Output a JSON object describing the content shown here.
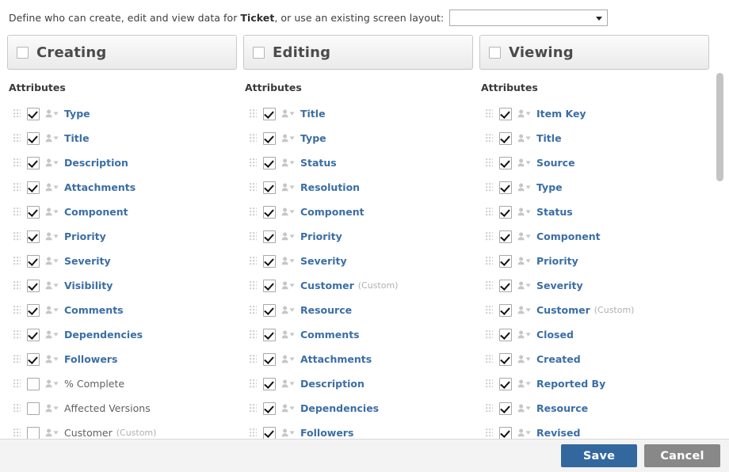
{
  "instruction": {
    "prefix": "Define who can create, edit and view data for ",
    "entity": "Ticket",
    "suffix": ", or use an existing screen layout:"
  },
  "layout_select": {
    "name": "screen-layout-select",
    "value": "",
    "placeholder": "",
    "caret_icon": "chevron-down-icon"
  },
  "attributes_heading": "Attributes",
  "icons": {
    "drag_handle": "drag-handle-icon",
    "person": "person-icon",
    "person_caret": "chevron-down-icon"
  },
  "colors": {
    "label_active": "#3b6ea5",
    "label_inactive": "#616161",
    "save_button": "#33689e",
    "cancel_button": "#888888",
    "panel_bg": "#f3f3f3"
  },
  "columns": [
    {
      "id": "creating",
      "title": "Creating",
      "header_checkbox_checked": false,
      "attributes_heading": "Attributes",
      "items": [
        {
          "label": "Type",
          "suffix": "",
          "checked": true
        },
        {
          "label": "Title",
          "suffix": "",
          "checked": true
        },
        {
          "label": "Description",
          "suffix": "",
          "checked": true
        },
        {
          "label": "Attachments",
          "suffix": "",
          "checked": true
        },
        {
          "label": "Component",
          "suffix": "",
          "checked": true
        },
        {
          "label": "Priority",
          "suffix": "",
          "checked": true
        },
        {
          "label": "Severity",
          "suffix": "",
          "checked": true
        },
        {
          "label": "Visibility",
          "suffix": "",
          "checked": true
        },
        {
          "label": "Comments",
          "suffix": "",
          "checked": true
        },
        {
          "label": "Dependencies",
          "suffix": "",
          "checked": true
        },
        {
          "label": "Followers",
          "suffix": "",
          "checked": true
        },
        {
          "label": "% Complete",
          "suffix": "",
          "checked": false
        },
        {
          "label": "Affected Versions",
          "suffix": "",
          "checked": false
        },
        {
          "label": "Customer",
          "suffix": "(Custom)",
          "checked": false
        }
      ]
    },
    {
      "id": "editing",
      "title": "Editing",
      "header_checkbox_checked": false,
      "attributes_heading": "Attributes",
      "items": [
        {
          "label": "Title",
          "suffix": "",
          "checked": true
        },
        {
          "label": "Type",
          "suffix": "",
          "checked": true
        },
        {
          "label": "Status",
          "suffix": "",
          "checked": true
        },
        {
          "label": "Resolution",
          "suffix": "",
          "checked": true
        },
        {
          "label": "Component",
          "suffix": "",
          "checked": true
        },
        {
          "label": "Priority",
          "suffix": "",
          "checked": true
        },
        {
          "label": "Severity",
          "suffix": "",
          "checked": true
        },
        {
          "label": "Customer",
          "suffix": "(Custom)",
          "checked": true
        },
        {
          "label": "Resource",
          "suffix": "",
          "checked": true
        },
        {
          "label": "Comments",
          "suffix": "",
          "checked": true
        },
        {
          "label": "Attachments",
          "suffix": "",
          "checked": true
        },
        {
          "label": "Description",
          "suffix": "",
          "checked": true
        },
        {
          "label": "Dependencies",
          "suffix": "",
          "checked": true
        },
        {
          "label": "Followers",
          "suffix": "",
          "checked": true
        }
      ]
    },
    {
      "id": "viewing",
      "title": "Viewing",
      "header_checkbox_checked": false,
      "attributes_heading": "Attributes",
      "items": [
        {
          "label": "Item Key",
          "suffix": "",
          "checked": true
        },
        {
          "label": "Title",
          "suffix": "",
          "checked": true
        },
        {
          "label": "Source",
          "suffix": "",
          "checked": true
        },
        {
          "label": "Type",
          "suffix": "",
          "checked": true
        },
        {
          "label": "Status",
          "suffix": "",
          "checked": true
        },
        {
          "label": "Component",
          "suffix": "",
          "checked": true
        },
        {
          "label": "Priority",
          "suffix": "",
          "checked": true
        },
        {
          "label": "Severity",
          "suffix": "",
          "checked": true
        },
        {
          "label": "Customer",
          "suffix": "(Custom)",
          "checked": true
        },
        {
          "label": "Closed",
          "suffix": "",
          "checked": true
        },
        {
          "label": "Created",
          "suffix": "",
          "checked": true
        },
        {
          "label": "Reported By",
          "suffix": "",
          "checked": true
        },
        {
          "label": "Resource",
          "suffix": "",
          "checked": true
        },
        {
          "label": "Revised",
          "suffix": "",
          "checked": true
        }
      ]
    }
  ],
  "footer": {
    "save_label": "Save",
    "cancel_label": "Cancel"
  }
}
